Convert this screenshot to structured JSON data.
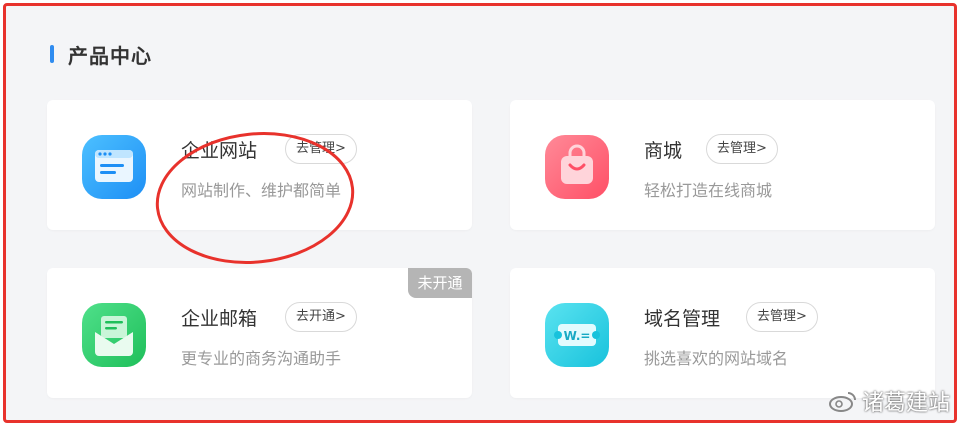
{
  "section": {
    "title": "产品中心"
  },
  "products": [
    {
      "name": "企业网站",
      "action": "去管理>",
      "desc": "网站制作、维护都简单",
      "icon": "website-icon",
      "color": "#2aa7ff"
    },
    {
      "name": "商城",
      "action": "去管理>",
      "desc": "轻松打造在线商城",
      "icon": "shopping-bag-icon",
      "color": "#ff6b7d"
    },
    {
      "name": "企业邮箱",
      "action": "去开通>",
      "desc": "更专业的商务沟通助手",
      "icon": "mail-icon",
      "color": "#2ecf6a",
      "badge": "未开通"
    },
    {
      "name": "域名管理",
      "action": "去管理>",
      "desc": "挑选喜欢的网站域名",
      "icon": "domain-icon",
      "color": "#29d3e6",
      "icon_text": "W.="
    }
  ],
  "watermark": "诸葛建站",
  "colors": {
    "frame": "#e8322c",
    "accent": "#2f8cf0",
    "annotation": "#e8322c"
  }
}
